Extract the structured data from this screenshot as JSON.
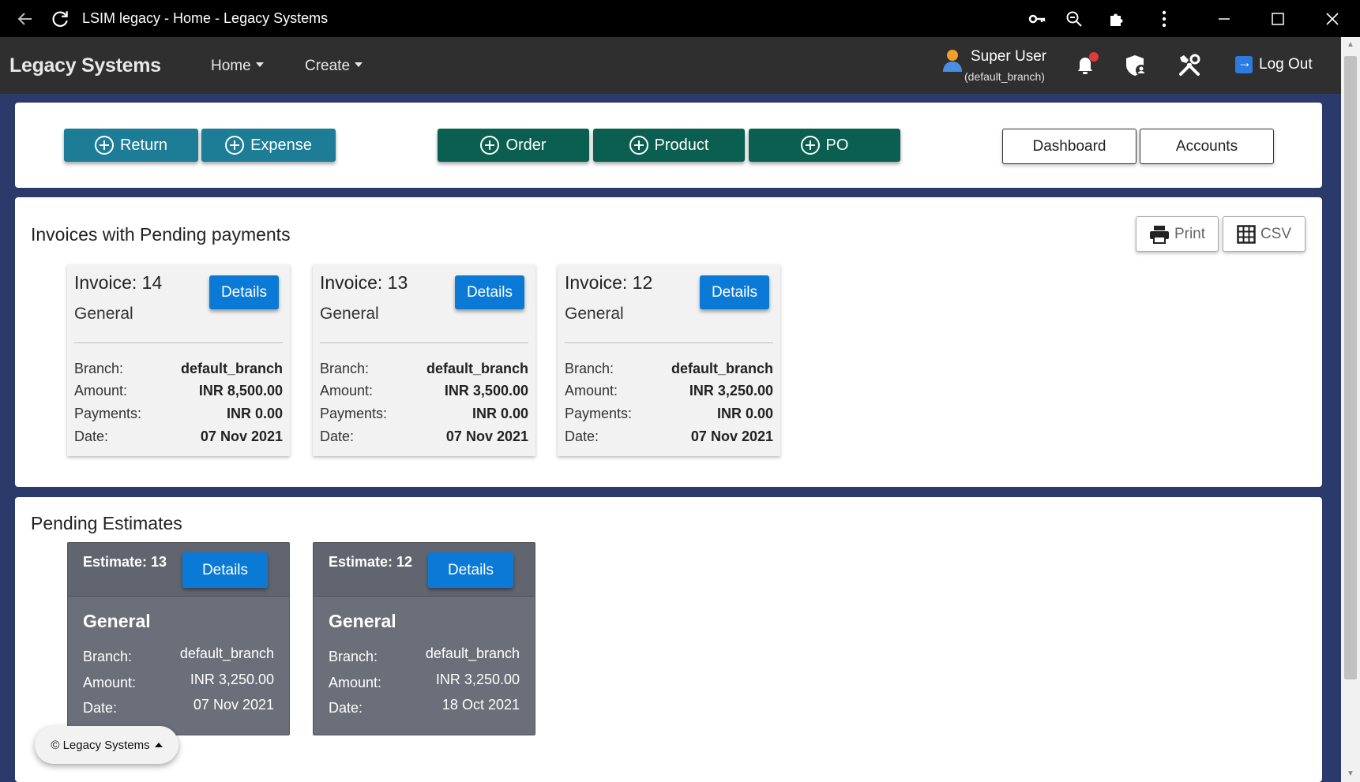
{
  "browser": {
    "title": "LSIM legacy - Home - Legacy Systems"
  },
  "navbar": {
    "brand": "Legacy Systems",
    "menu": [
      {
        "label": "Home"
      },
      {
        "label": "Create"
      }
    ],
    "user": {
      "name": "Super User",
      "branch": "(default_branch)"
    },
    "logout_label": "Log Out"
  },
  "actions": {
    "return_label": "Return",
    "expense_label": "Expense",
    "order_label": "Order",
    "product_label": "Product",
    "po_label": "PO",
    "dashboard_label": "Dashboard",
    "accounts_label": "Accounts"
  },
  "invoices": {
    "title": "Invoices with Pending payments",
    "print_label": "Print",
    "csv_label": "CSV",
    "labels": {
      "branch": "Branch:",
      "amount": "Amount:",
      "payments": "Payments:",
      "date": "Date:"
    },
    "details_label": "Details",
    "items": [
      {
        "number": "Invoice: 14",
        "type": "General",
        "branch": "default_branch",
        "amount": "INR 8,500.00",
        "payments": "INR 0.00",
        "date": "07 Nov 2021"
      },
      {
        "number": "Invoice: 13",
        "type": "General",
        "branch": "default_branch",
        "amount": "INR 3,500.00",
        "payments": "INR 0.00",
        "date": "07 Nov 2021"
      },
      {
        "number": "Invoice: 12",
        "type": "General",
        "branch": "default_branch",
        "amount": "INR 3,250.00",
        "payments": "INR 0.00",
        "date": "07 Nov 2021"
      }
    ]
  },
  "estimates": {
    "title": "Pending Estimates",
    "labels": {
      "branch": "Branch:",
      "amount": "Amount:",
      "date": "Date:"
    },
    "details_label": "Details",
    "items": [
      {
        "number": "Estimate: 13",
        "type": "General",
        "branch": "default_branch",
        "amount": "INR 3,250.00",
        "date": "07 Nov 2021"
      },
      {
        "number": "Estimate: 12",
        "type": "General",
        "branch": "default_branch",
        "amount": "INR 3,250.00",
        "date": "18 Oct 2021"
      }
    ]
  },
  "footer": {
    "label": "© Legacy Systems"
  },
  "colors": {
    "teal_button": "#1d7d96",
    "green_button": "#0b5f50",
    "details_button": "#0a7ad6",
    "estimate_card": "#6a6f7a",
    "notification_dot": "#e53935"
  }
}
